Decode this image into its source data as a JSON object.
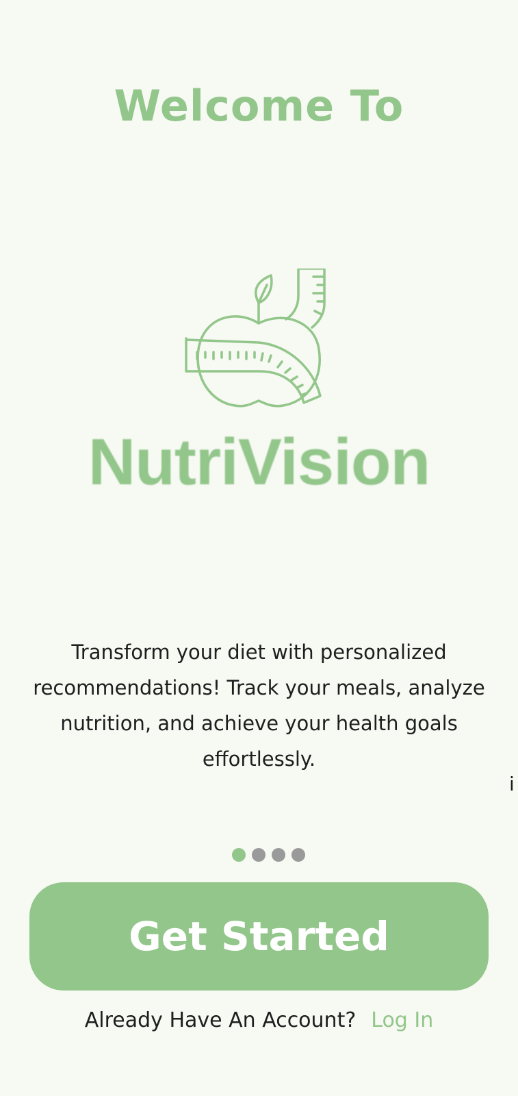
{
  "welcome": {
    "title": "Welcome To"
  },
  "brand": {
    "name": "NutriVision",
    "logo_icon": "apple-with-measuring-tape-icon"
  },
  "description": "Transform your diet with personalized recommendations! Track your meals, analyze nutrition, and achieve your health goals effortlessly.",
  "edge_text": "i",
  "pagination": {
    "total": 4,
    "active_index": 0
  },
  "cta": {
    "label": "Get Started"
  },
  "login": {
    "prompt": "Already Have An Account?",
    "link_label": "Log In"
  },
  "colors": {
    "accent": "#92c68a",
    "background": "#f7f9f3",
    "text": "#1e1e1e",
    "dot_inactive": "#9a9a9a",
    "button_text": "#ffffff"
  }
}
